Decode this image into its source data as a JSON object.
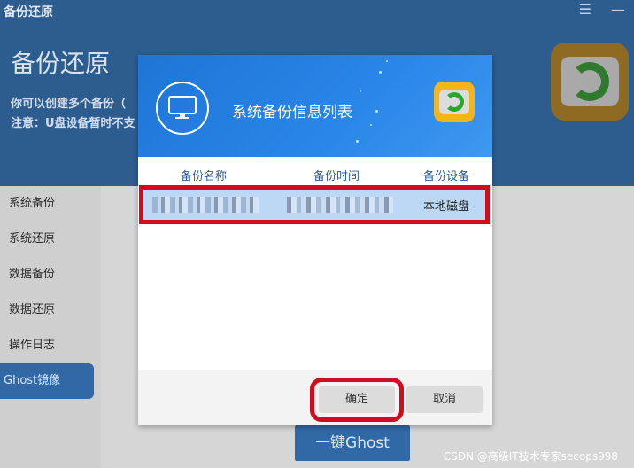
{
  "app": {
    "window_title": "备份还原",
    "header_title": "备份还原",
    "desc_line1": "你可以创建多个备份（",
    "desc_line2": "注意：U盘设备暂时不支",
    "menu_icon": "menu-icon",
    "minimize_icon": "minimize-icon",
    "accent_color": "#3169a6"
  },
  "sidebar": {
    "items": [
      {
        "label": "系统备份"
      },
      {
        "label": "系统还原"
      },
      {
        "label": "数据备份"
      },
      {
        "label": "数据还原"
      },
      {
        "label": "操作日志"
      },
      {
        "label": "Ghost镜像",
        "active": true
      }
    ]
  },
  "main": {
    "ghost_button": "一键Ghost"
  },
  "modal": {
    "title": "系统备份信息列表",
    "columns": [
      "备份名称",
      "备份时间",
      "备份设备"
    ],
    "rows": [
      {
        "device": "本地磁盘"
      }
    ],
    "confirm_label": "确定",
    "cancel_label": "取消",
    "highlight_color": "#d20c1e"
  },
  "watermark": "CSDN @高级IT技术专家secops998"
}
